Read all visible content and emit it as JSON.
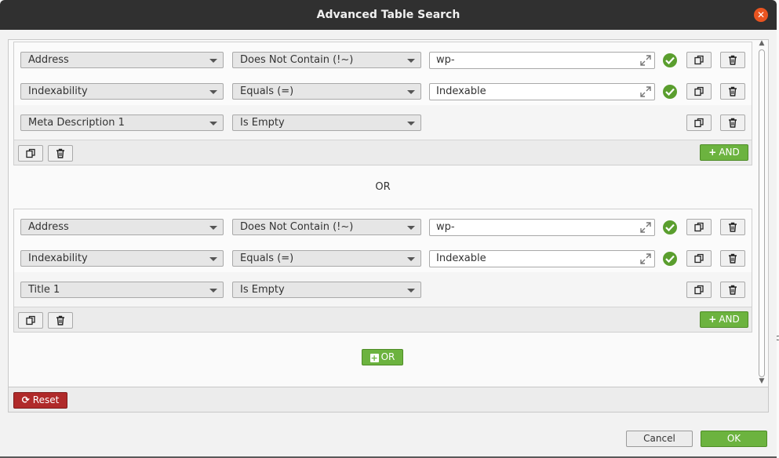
{
  "dialog": {
    "title": "Advanced Table Search",
    "close_icon": "close-icon",
    "accent_color": "#6cb33f",
    "reset_color": "#b02a2a"
  },
  "groups": [
    {
      "rows": [
        {
          "field": "Address",
          "operator": "Does Not Contain (!~)",
          "value": "wp-",
          "valid": true
        },
        {
          "field": "Indexability",
          "operator": "Equals (=)",
          "value": "Indexable",
          "valid": true
        },
        {
          "field": "Meta Description 1",
          "operator": "Is Empty"
        }
      ],
      "and_label": "AND"
    },
    {
      "rows": [
        {
          "field": "Address",
          "operator": "Does Not Contain (!~)",
          "value": "wp-",
          "valid": true
        },
        {
          "field": "Indexability",
          "operator": "Equals (=)",
          "value": "Indexable",
          "valid": true
        },
        {
          "field": "Title 1",
          "operator": "Is Empty"
        }
      ],
      "and_label": "AND"
    }
  ],
  "or_separator": "OR",
  "or_button_label": "OR",
  "reset_label": "Reset",
  "cancel_label": "Cancel",
  "ok_label": "OK",
  "background_fragment": "c"
}
